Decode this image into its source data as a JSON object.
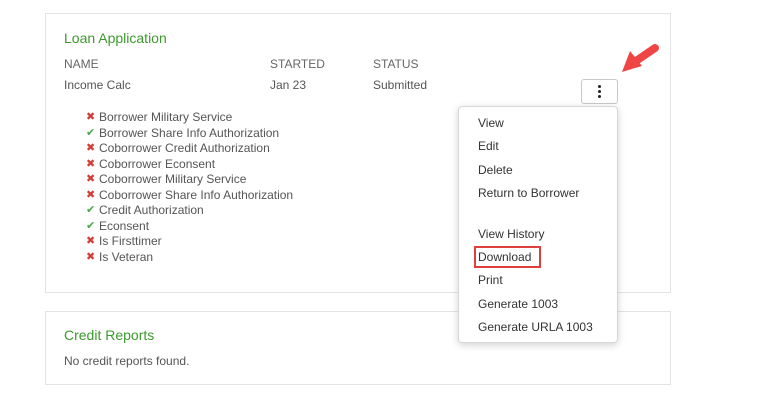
{
  "loan_card": {
    "title": "Loan Application",
    "columns": {
      "name": "NAME",
      "started": "STARTED",
      "status": "STATUS"
    },
    "row": {
      "name": "Income Calc",
      "started": "Jan 23",
      "status": "Submitted"
    },
    "checklist": [
      {
        "label": "Borrower Military Service",
        "done": false
      },
      {
        "label": "Borrower Share Info Authorization",
        "done": true
      },
      {
        "label": "Coborrower Credit Authorization",
        "done": false
      },
      {
        "label": "Coborrower Econsent",
        "done": false
      },
      {
        "label": "Coborrower Military Service",
        "done": false
      },
      {
        "label": "Coborrower Share Info Authorization",
        "done": false
      },
      {
        "label": "Credit Authorization",
        "done": true
      },
      {
        "label": "Econsent",
        "done": true
      },
      {
        "label": "Is Firsttimer",
        "done": false
      },
      {
        "label": "Is Veteran",
        "done": false
      }
    ]
  },
  "actions_menu": {
    "items": [
      "View",
      "Edit",
      "Delete",
      "Return to Borrower",
      "View History",
      "Download",
      "Print",
      "Generate 1003",
      "Generate URLA 1003"
    ],
    "highlighted": "Download"
  },
  "credit_card": {
    "title": "Credit Reports",
    "empty_text": "No credit reports found."
  },
  "colors": {
    "title_green": "#3c9a2c",
    "check_green": "#4aa84a",
    "cross_red": "#d43b35",
    "highlight_red": "#e0403c",
    "arrow_red": "#f04545"
  },
  "icons": {
    "check": "check-icon",
    "cross": "cross-icon",
    "kebab": "kebab-menu-icon",
    "arrow": "arrow-pointer-icon"
  }
}
